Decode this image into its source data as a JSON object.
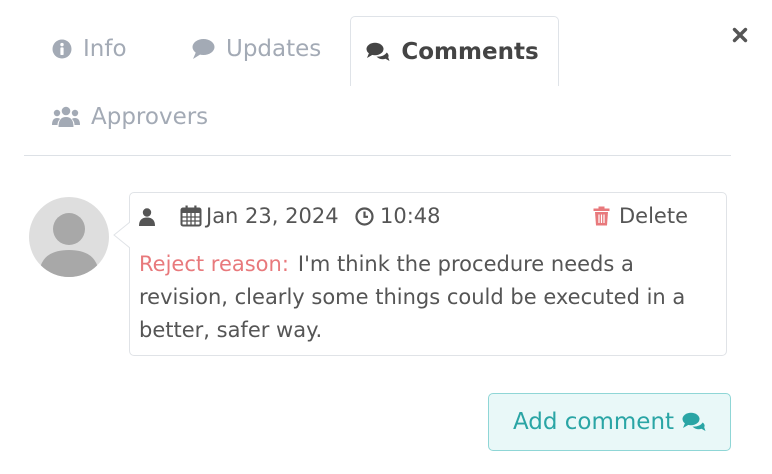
{
  "tabs": [
    {
      "label": "Info",
      "icon": "info-circle-icon",
      "active": false
    },
    {
      "label": "Updates",
      "icon": "speech-bubble-icon",
      "active": false
    },
    {
      "label": "Comments",
      "icon": "comments-icon",
      "active": true
    },
    {
      "label": "Approvers",
      "icon": "users-icon",
      "active": false
    }
  ],
  "close_icon": "close-icon",
  "comment": {
    "avatar_icon": "user-avatar-icon",
    "author_icon": "user-icon",
    "date": "Jan 23, 2024",
    "time": "10:48",
    "delete_label": "Delete",
    "reject_label": "Reject reason:",
    "text": "I'm think the procedure needs a revision, clearly some things could be executed in a better, safer way."
  },
  "add_comment_label": "Add comment",
  "colors": {
    "accent": "#2aa5a5",
    "danger": "#e8797c",
    "tab_inactive": "#a3aab5",
    "text": "#555555"
  }
}
